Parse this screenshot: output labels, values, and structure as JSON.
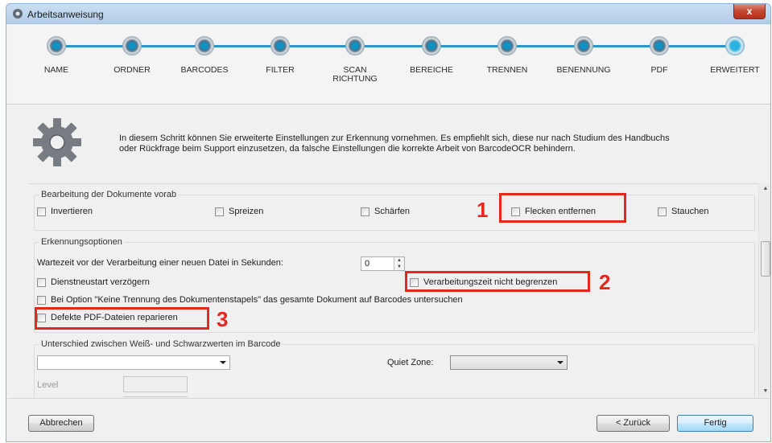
{
  "window": {
    "title": "Arbeitsanweisung",
    "close_label": "x"
  },
  "steps": [
    {
      "label": "NAME"
    },
    {
      "label": "ORDNER"
    },
    {
      "label": "BARCODES"
    },
    {
      "label": "FILTER"
    },
    {
      "label": "SCAN\nRICHTUNG"
    },
    {
      "label": "BEREICHE"
    },
    {
      "label": "TRENNEN"
    },
    {
      "label": "BENENNUNG"
    },
    {
      "label": "PDF"
    },
    {
      "label": "ERWEITERT"
    }
  ],
  "header": {
    "line1": "In diesem Schritt können Sie erweiterte Einstellungen zur Erkennung vornehmen. Es empfiehlt sich, diese nur nach Studium des Handbuchs",
    "line2": "oder Rückfrage beim Support einzusetzen, da falsche Einstellungen die korrekte Arbeit von BarcodeOCR behindern."
  },
  "group_preprocess": {
    "title": "Bearbeitung der Dokumente vorab",
    "options": [
      "Invertieren",
      "Spreizen",
      "Schärfen",
      "Flecken entfernen",
      "Stauchen"
    ]
  },
  "group_recognition": {
    "title": "Erkennungsoptionen",
    "wait_label": "Wartezeit vor der Verarbeitung einer neuen Datei in Sekunden:",
    "wait_value": "0",
    "delay_restart": "Dienstneustart verzögern",
    "unlimited_time": "Verarbeitungszeit nicht begrenzen",
    "whole_doc": "Bei Option \"Keine Trennung des Dokumentenstapels\" das gesamte Dokument auf Barcodes untersuchen",
    "repair_pdf": "Defekte PDF-Dateien reparieren"
  },
  "group_contrast": {
    "title": "Unterschied zwischen Weiß- und Schwarzwerten im Barcode",
    "quiet_zone_label": "Quiet Zone:",
    "level_label": "Level"
  },
  "annotations": [
    "1",
    "2",
    "3"
  ],
  "footer": {
    "cancel": "Abbrechen",
    "back": "< Zurück",
    "finish": "Fertig"
  },
  "colors": {
    "accent": "#2d96c7",
    "annotation": "#e5281d"
  }
}
